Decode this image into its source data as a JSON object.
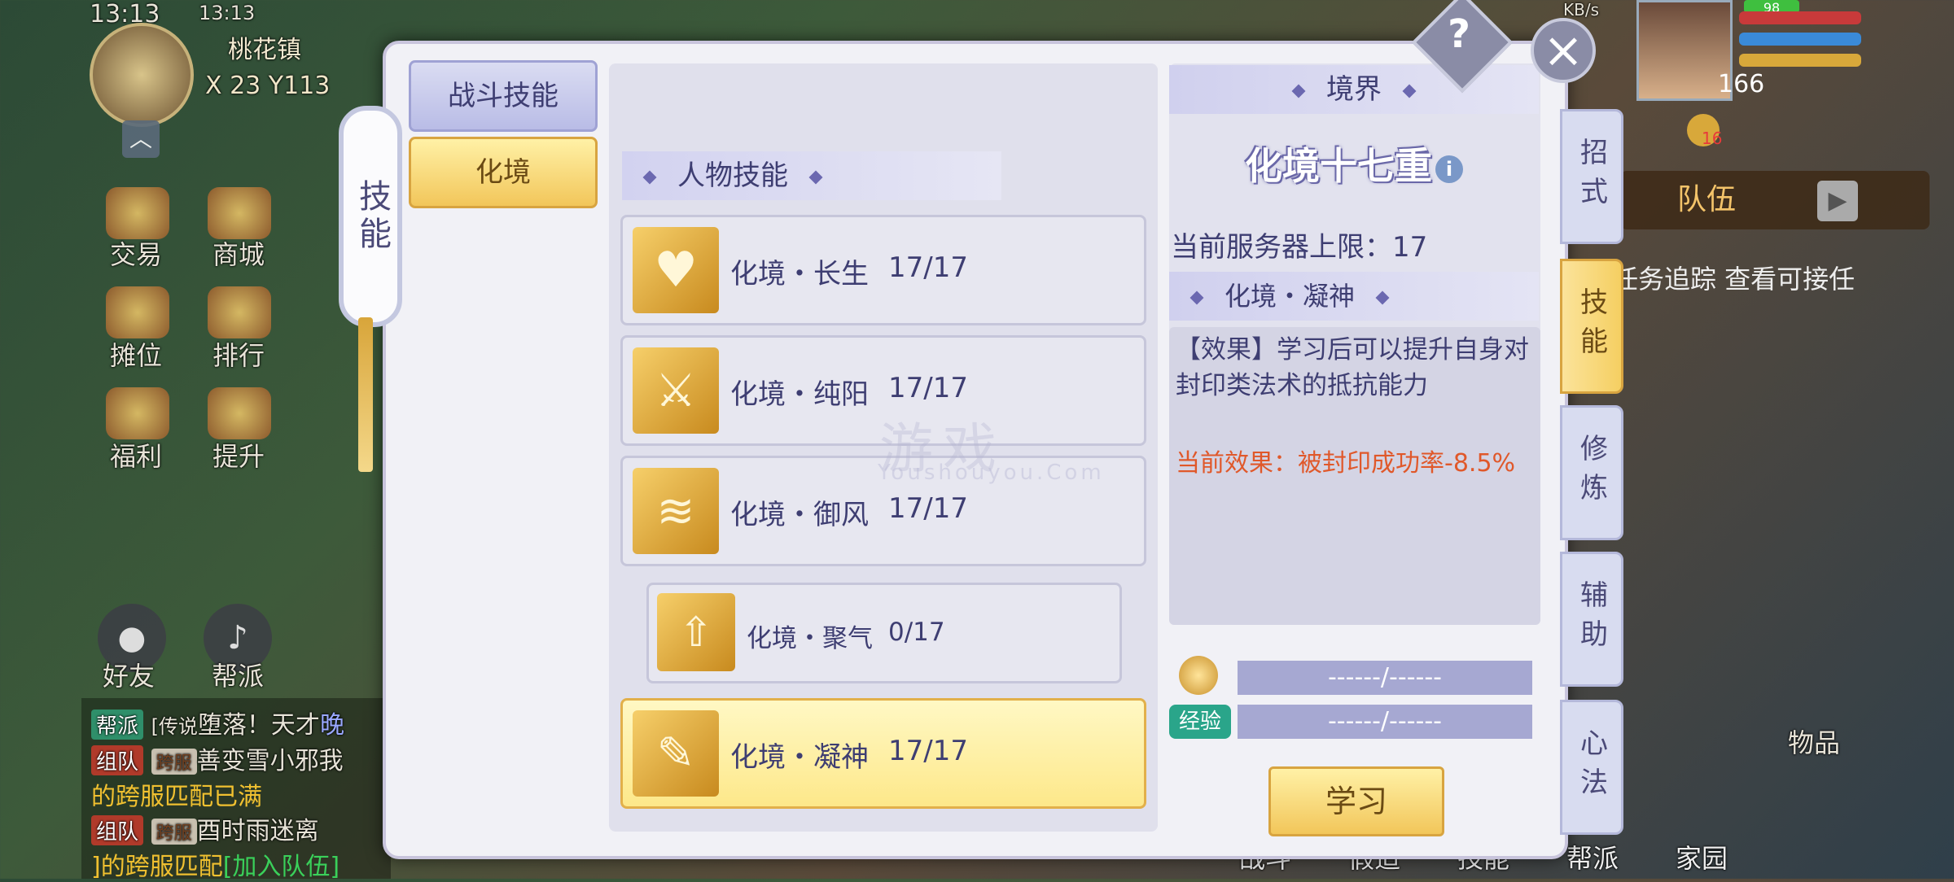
{
  "status_bar": {
    "clock": "13:13",
    "mini_clock": "13:13",
    "network": "KB/s",
    "battery": "98"
  },
  "map": {
    "name": "桃花镇",
    "coords": "X 23   Y113"
  },
  "left_menu": [
    "交易",
    "商城",
    "摊位",
    "排行",
    "福利",
    "提升"
  ],
  "voice_buttons": [
    "好友",
    "帮派"
  ],
  "chat": [
    {
      "tag": "帮派",
      "channel": "[传说",
      "text": "堕落！天才",
      "tail": "晚"
    },
    {
      "tag": "组队",
      "channel": "跨服",
      "text": "善变雪小邪",
      "tail": "我"
    },
    {
      "tag": "",
      "channel": "",
      "text": "的跨服匹配已满",
      "tail": ""
    },
    {
      "tag": "组队",
      "channel": "跨服",
      "text": "酉时雨迷离",
      "tail": ""
    },
    {
      "tag": "",
      "channel": "",
      "text": "]的跨服匹配",
      "tail": "[加入队伍]"
    }
  ],
  "player": {
    "level": "166",
    "badge": "16"
  },
  "team": {
    "label": "队伍"
  },
  "quest_hint": "任务追踪 查看可接任",
  "bottom_bar": [
    "战斗",
    "假造",
    "技能",
    "帮派",
    "家园"
  ],
  "bag_label": "物品",
  "modal": {
    "scroll_title": "技能",
    "categories": {
      "combat": "战斗技能",
      "realm": "化境"
    },
    "section_title": "人物技能",
    "skills": [
      {
        "name": "化境・长生",
        "level": "17/17",
        "icon": "heart-icon"
      },
      {
        "name": "化境・纯阳",
        "level": "17/17",
        "icon": "sword-icon"
      },
      {
        "name": "化境・御风",
        "level": "17/17",
        "icon": "wind-icon"
      },
      {
        "name": "化境・聚气",
        "level": "0/17",
        "icon": "gather-icon"
      },
      {
        "name": "化境・凝神",
        "level": "17/17",
        "icon": "scroll-icon"
      }
    ],
    "detail": {
      "realm_head": "境界",
      "realm_title": "化境十七重",
      "info": "i",
      "server_limit": "当前服务器上限：17",
      "skill_head": "化境・凝神",
      "effect": "【效果】学习后可以提升自身对封印类法术的抵抗能力",
      "current_effect": "当前效果：被封印成功率-8.5%",
      "exp_label": "经验",
      "cost_money": "------/------",
      "cost_exp": "------/------",
      "learn": "学习"
    },
    "side_tabs": [
      "招式",
      "技能",
      "修炼",
      "辅助",
      "心法"
    ],
    "help": "?",
    "close": "×"
  },
  "watermark": {
    "main": "游戏",
    "sub": "Youshouyou.Com"
  }
}
